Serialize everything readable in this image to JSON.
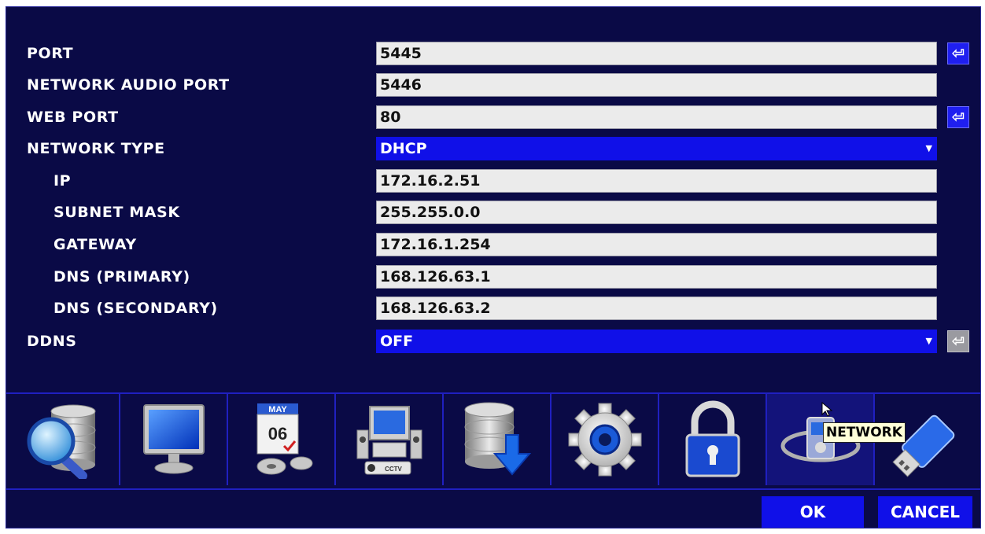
{
  "settings": [
    {
      "label": "PORT",
      "value": "5445",
      "type": "input",
      "enter": true
    },
    {
      "label": "NETWORK AUDIO PORT",
      "value": "5446",
      "type": "input",
      "enter": false
    },
    {
      "label": "WEB PORT",
      "value": "80",
      "type": "input",
      "enter": true
    },
    {
      "label": "NETWORK TYPE",
      "value": "DHCP",
      "type": "select",
      "enter": false
    },
    {
      "label": "IP",
      "value": "172.16.2.51",
      "type": "input",
      "enter": false
    },
    {
      "label": "SUBNET MASK",
      "value": "255.255.0.0",
      "type": "input",
      "enter": false
    },
    {
      "label": "GATEWAY",
      "value": "172.16.1.254",
      "type": "input",
      "enter": false
    },
    {
      "label": "DNS (PRIMARY)",
      "value": "168.126.63.1",
      "type": "input",
      "enter": false
    },
    {
      "label": "DNS (SECONDARY)",
      "value": "168.126.63.2",
      "type": "input",
      "enter": false
    },
    {
      "label": "DDNS",
      "value": "OFF",
      "type": "select",
      "enter": "disabled"
    }
  ],
  "iconbar": {
    "items": [
      {
        "icon": "database-search-icon"
      },
      {
        "icon": "monitor-icon"
      },
      {
        "icon": "calendar-schedule-icon",
        "calendar_month": "MAY",
        "calendar_day": "06"
      },
      {
        "icon": "dvr-system-icon",
        "device_label": "CCTV"
      },
      {
        "icon": "database-backup-icon"
      },
      {
        "icon": "gear-icon"
      },
      {
        "icon": "padlock-icon"
      },
      {
        "icon": "network-globe-icon",
        "active": true
      },
      {
        "icon": "usb-drive-icon"
      }
    ],
    "tooltip": "NETWORK"
  },
  "buttons": {
    "ok": "OK",
    "cancel": "CANCEL"
  },
  "colors": {
    "background": "#0a0a46",
    "field_bg": "#ebebeb",
    "select_bg": "#1010e8",
    "accent": "#1f1ff0",
    "disabled": "#9a9aa0",
    "tooltip_bg": "#ffffd8"
  }
}
